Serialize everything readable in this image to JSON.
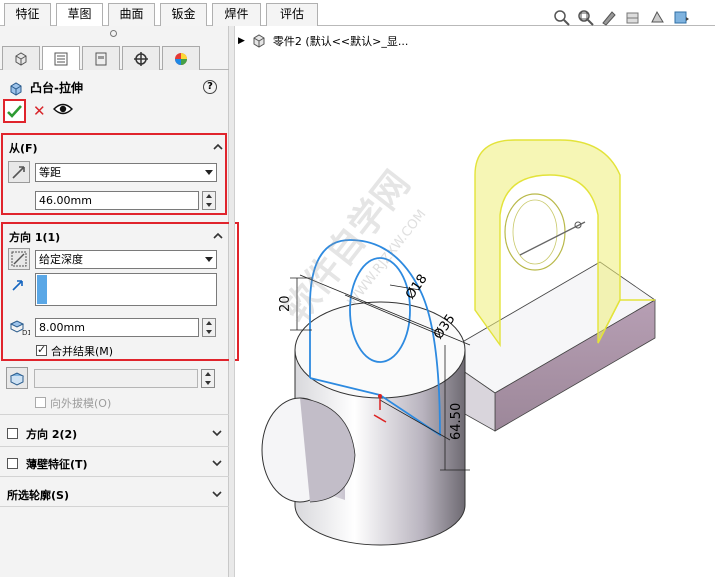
{
  "tabs": [
    {
      "label": "特征"
    },
    {
      "label": "草图"
    },
    {
      "label": "曲面"
    },
    {
      "label": "钣金"
    },
    {
      "label": "焊件"
    },
    {
      "label": "评估"
    }
  ],
  "active_tab": "草图",
  "feature": {
    "title": "凸台-拉伸",
    "help": "?"
  },
  "from_group": {
    "header": "从(F)",
    "type": "等距",
    "offset": "46.00mm"
  },
  "direction1": {
    "header": "方向 1(1)",
    "end_condition": "给定深度",
    "depth": "8.00mm",
    "merge_label": "合并结果(M)",
    "merge_checked": true
  },
  "draft": {
    "label": "向外拔模(O)"
  },
  "direction2": {
    "header": "方向 2(2)"
  },
  "thin": {
    "header": "薄壁特征(T)"
  },
  "contours": {
    "header": "所选轮廓(S)"
  },
  "tree": {
    "label": "零件2  (默认<<默认>_显..."
  },
  "dims": {
    "d20": "20",
    "dia18": "Ø18",
    "dia35": "Ø35",
    "d6450": "64.50"
  },
  "watermark": {
    "text": "软件自学网",
    "url": "WWW.RJZXW.COM"
  },
  "colors": {
    "accent_red": "#e0242c",
    "sketch_blue": "#1e88e5",
    "yellow": "#e8e85a"
  }
}
